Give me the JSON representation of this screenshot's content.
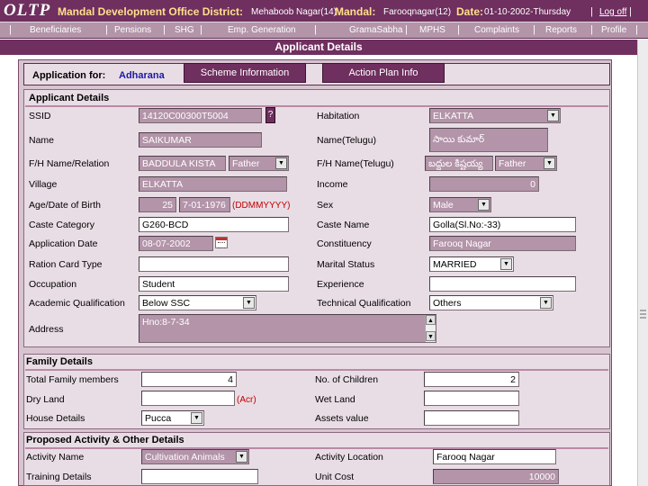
{
  "header": {
    "logo": "OLTP",
    "title": "Mandal Development Office District:",
    "district_value": "Mehaboob Nagar(14)",
    "mandal_label": "Mandal:",
    "mandal_value": "Farooqnagar(12)",
    "date_label": "Date:",
    "date_value": "01-10-2002-Thursday",
    "logoff": "Log off"
  },
  "nav": {
    "items": [
      "Beneficiaries",
      "Pensions",
      "SHG",
      "Emp. Generation",
      "GramaSabha",
      "MPHS",
      "Complaints",
      "Reports",
      "Profile"
    ]
  },
  "page_title": "Applicant Details",
  "application": {
    "label": "Application for:",
    "value": "Adharana",
    "tabs": [
      "Scheme Information",
      "Action Plan Info"
    ]
  },
  "applicant": {
    "heading": "Applicant Details",
    "ssid_label": "SSID",
    "ssid_value": "14120C00300T5004",
    "ssid_help": "?",
    "habitation_label": "Habitation",
    "habitation_value": "ELKATTA",
    "name_label": "Name",
    "name_value": "SAIKUMAR",
    "name_telugu_label": "Name(Telugu)",
    "name_telugu_value": "సాయి కుమార్",
    "fh_label": "F/H Name/Relation",
    "fh_value": "BADDULA KISTA",
    "fh_relation": "Father",
    "fh_telugu_label": "F/H Name(Telugu)",
    "fh_telugu_value": "బద్దుల కిష్టయ్య",
    "fh_telugu_relation": "Father",
    "village_label": "Village",
    "village_value": "ELKATTA",
    "income_label": "Income",
    "income_value": "0",
    "age_label": "Age/Date of Birth",
    "age_value": "25",
    "dob_value": "7-01-1976",
    "dob_hint": "(DDMMYYYY)",
    "sex_label": "Sex",
    "sex_value": "Male",
    "caste_cat_label": "Caste Category",
    "caste_cat_value": "G260-BCD",
    "caste_name_label": "Caste Name",
    "caste_name_value": "Golla(Sl.No:-33)",
    "app_date_label": "Application Date",
    "app_date_value": "08-07-2002",
    "constituency_label": "Constituency",
    "constituency_value": "Farooq Nagar",
    "ration_label": "Ration Card Type",
    "ration_value": "",
    "marital_label": "Marital Status",
    "marital_value": "MARRIED",
    "occupation_label": "Occupation",
    "occupation_value": "Student",
    "experience_label": "Experience",
    "experience_value": "",
    "academic_label": "Academic Qualification",
    "academic_value": "Below SSC",
    "technical_label": "Technical Qualification",
    "technical_value": "Others",
    "address_label": "Address",
    "address_value": "Hno:8-7-34"
  },
  "family": {
    "heading": "Family Details",
    "total_label": "Total Family members",
    "total_value": "4",
    "children_label": "No. of Children",
    "children_value": "2",
    "dry_label": "Dry Land",
    "dry_value": "",
    "dry_unit": "(Acr)",
    "wet_label": "Wet Land",
    "wet_value": "",
    "house_label": "House Details",
    "house_value": "Pucca",
    "assets_label": "Assets value",
    "assets_value": ""
  },
  "activity": {
    "heading": "Proposed Activity & Other Details",
    "name_label": "Activity Name",
    "name_value": "Cultivation Animals",
    "location_label": "Activity Location",
    "location_value": "Farooq Nagar",
    "training_label": "Training Details",
    "training_value": "",
    "unit_cost_label": "Unit Cost",
    "unit_cost_value": "10000"
  },
  "colors": {
    "header_bg": "#6f2f5f",
    "nav_bg": "#b394a9",
    "panel_bg": "#e9dde5",
    "readonly_bg": "#b394a9",
    "title_accent": "#ffe08a"
  }
}
